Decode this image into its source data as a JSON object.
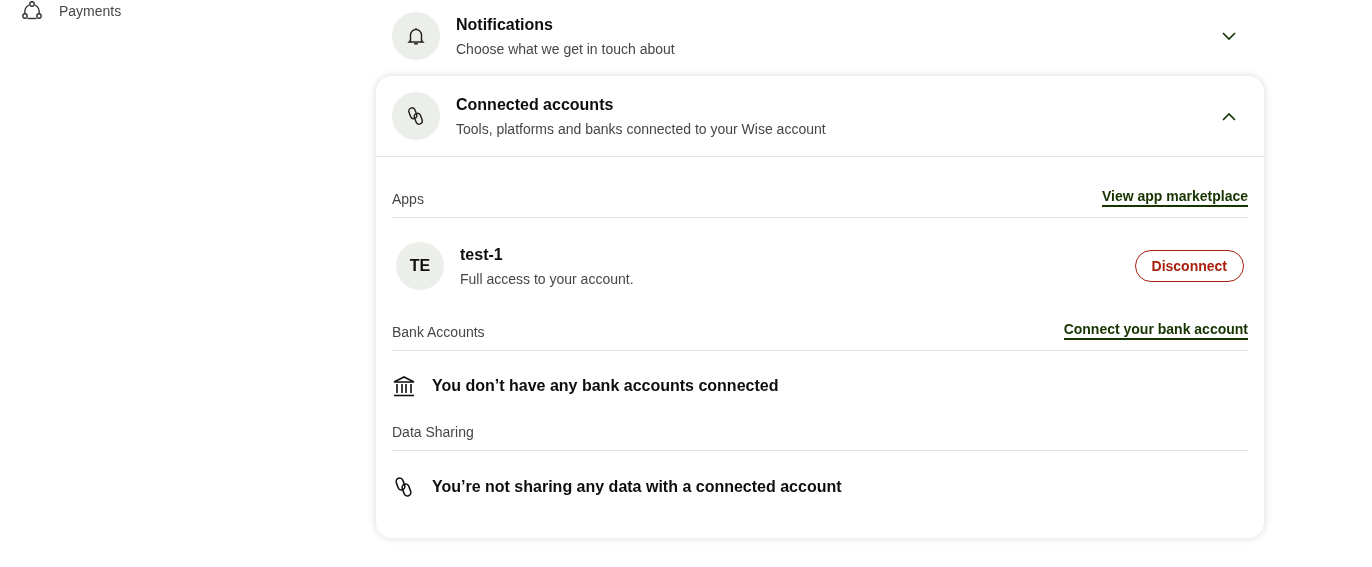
{
  "sidebar": {
    "items": [
      {
        "label": "Payments",
        "kind": "payments"
      }
    ]
  },
  "settings": [
    {
      "title": "Notifications",
      "subtitle": "Choose what we get in touch about",
      "kind": "bell",
      "expanded": false
    },
    {
      "title": "Connected accounts",
      "subtitle": "Tools, platforms and banks connected to your Wise account",
      "kind": "link",
      "expanded": true,
      "sections": [
        {
          "heading": "Apps",
          "action": "View app marketplace",
          "apps": [
            {
              "initials": "TE",
              "name": "test-1",
              "description": "Full access to your account.",
              "button": "Disconnect"
            }
          ]
        },
        {
          "heading": "Bank Accounts",
          "action": "Connect your bank account",
          "empty": {
            "kind": "bank",
            "message": "You don’t have any bank accounts connected"
          }
        },
        {
          "heading": "Data Sharing",
          "empty": {
            "kind": "link",
            "message": "You’re not sharing any data with a connected account"
          }
        }
      ]
    }
  ]
}
